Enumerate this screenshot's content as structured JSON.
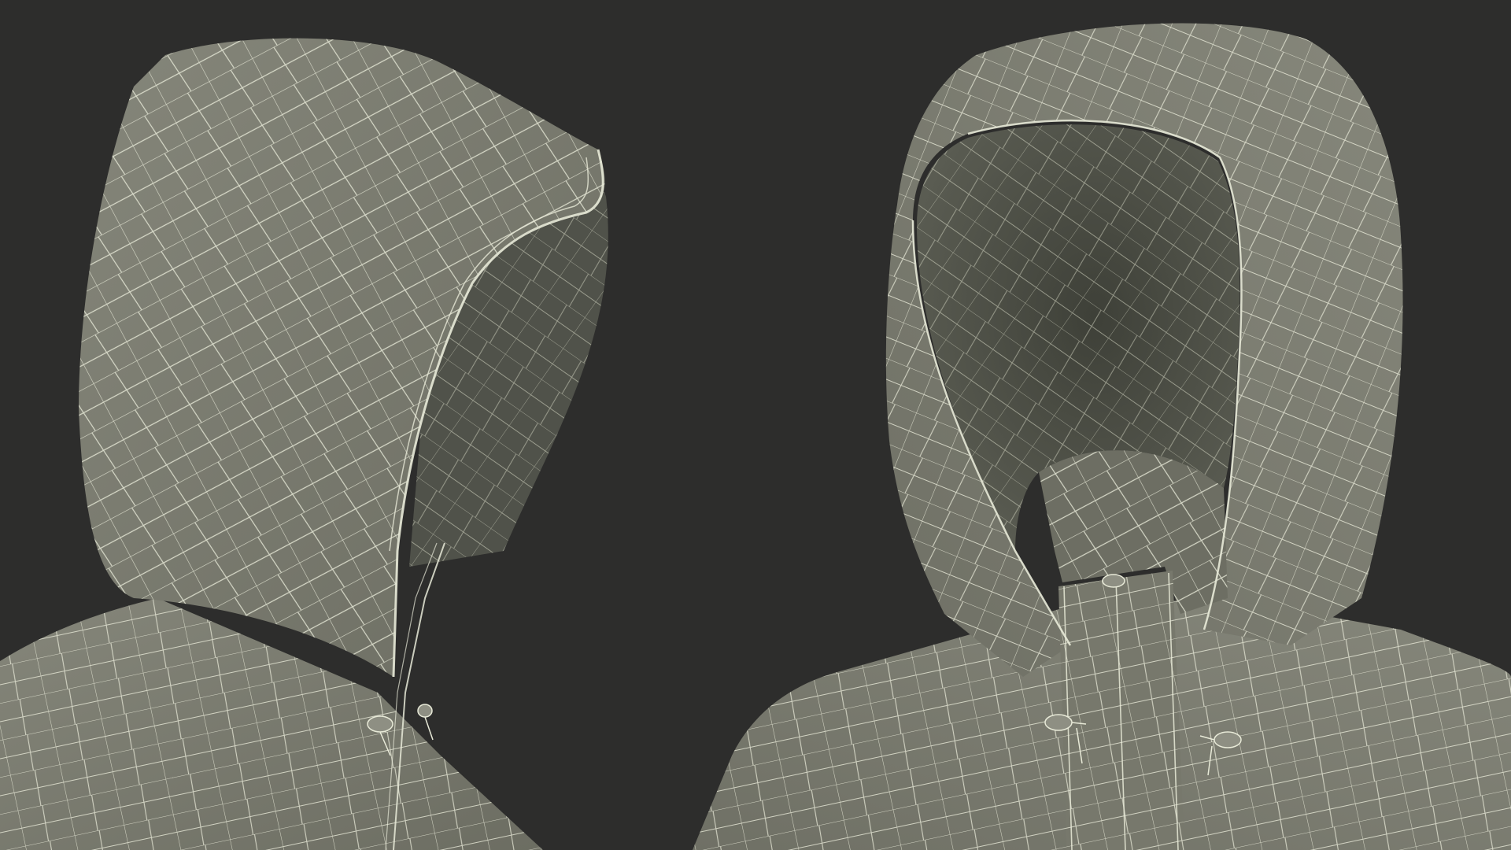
{
  "scene": {
    "background_color": "#2d2d2c",
    "mesh_fill_color": "#7a7a6e",
    "mesh_inner_color": "#54564c",
    "mesh_deep_color": "#3f4139",
    "wire_color": "#e8ead8",
    "views": [
      {
        "name": "hood-side-view"
      },
      {
        "name": "hood-front-view"
      }
    ]
  }
}
